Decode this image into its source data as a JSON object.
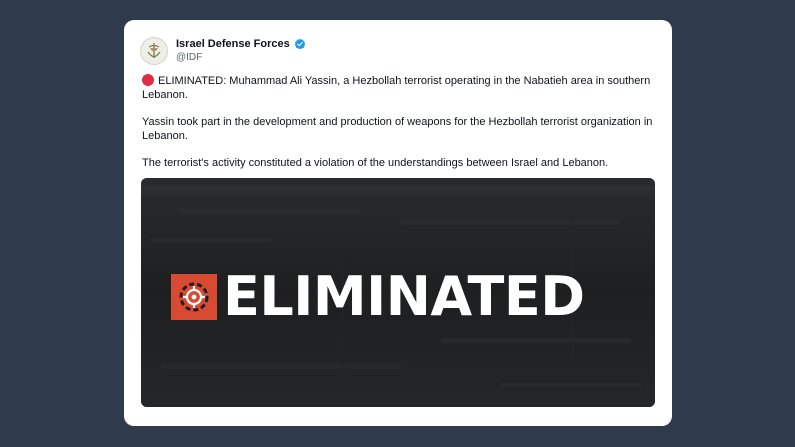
{
  "author": {
    "display_name": "Israel Defense Forces",
    "handle": "@IDF",
    "verified": true,
    "avatar_icon": "idf-emblem-icon"
  },
  "tweet": {
    "paragraphs": [
      "ELIMINATED: Muhammad Ali Yassin, a Hezbollah terrorist operating in the Nabatieh area in southern Lebanon.",
      "Yassin took part in the development and production of weapons for the Hezbollah terrorist organization in Lebanon.",
      "The terrorist's activity constituted a violation of the understandings between Israel and Lebanon."
    ],
    "lead_emoji": "red-circle-icon"
  },
  "media": {
    "banner_text": "ELIMINATED",
    "banner_icon": "crosshair-target-icon",
    "accent_color": "#d84a32",
    "background_color": "#1e1f21"
  },
  "colors": {
    "page_background": "#2f3a4c",
    "card_background": "#ffffff",
    "verified_badge": "#1d9bf0"
  }
}
